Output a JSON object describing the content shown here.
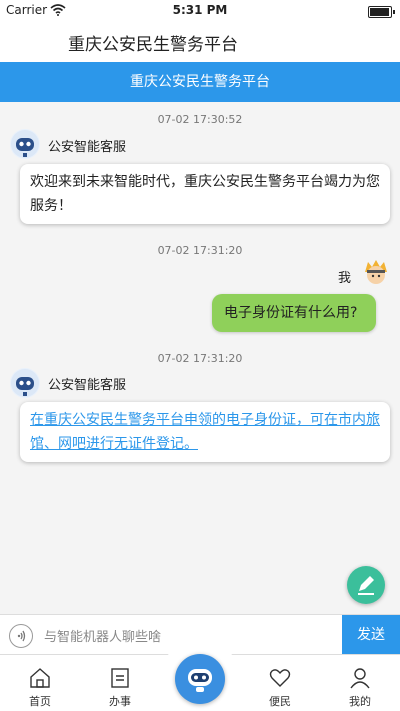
{
  "status_bar": {
    "carrier": "Carrier",
    "time": "5:31 PM",
    "battery_level": 0.95
  },
  "app_title": "重庆公安民生警务平台",
  "nav_title": "重庆公安民生警务平台",
  "messages": [
    {
      "timestamp": "07-02 17:30:52",
      "sender": "公安智能客服",
      "text": "欢迎来到未来智能时代，重庆公安民生警务平台竭力为您服务！"
    },
    {
      "timestamp": "07-02 17:31:20",
      "sender": "我",
      "text": "电子身份证有什么用?"
    },
    {
      "timestamp": "07-02 17:31:20",
      "sender": "公安智能客服",
      "text": "在重庆公安民生警务平台申领的电子身份证，可在市内旅馆、网吧进行无证件登记。"
    }
  ],
  "input": {
    "placeholder": "与智能机器人聊些啥",
    "send_label": "发送"
  },
  "tabs": [
    {
      "label": "首页",
      "icon": "home-icon"
    },
    {
      "label": "办事",
      "icon": "document-icon"
    },
    {
      "label": "",
      "icon": "robot-icon"
    },
    {
      "label": "便民",
      "icon": "heart-icon"
    },
    {
      "label": "我的",
      "icon": "user-icon"
    }
  ],
  "colors": {
    "primary": "#2c97ea",
    "user_bubble": "#8fd05a",
    "fab": "#3bbf9b"
  }
}
